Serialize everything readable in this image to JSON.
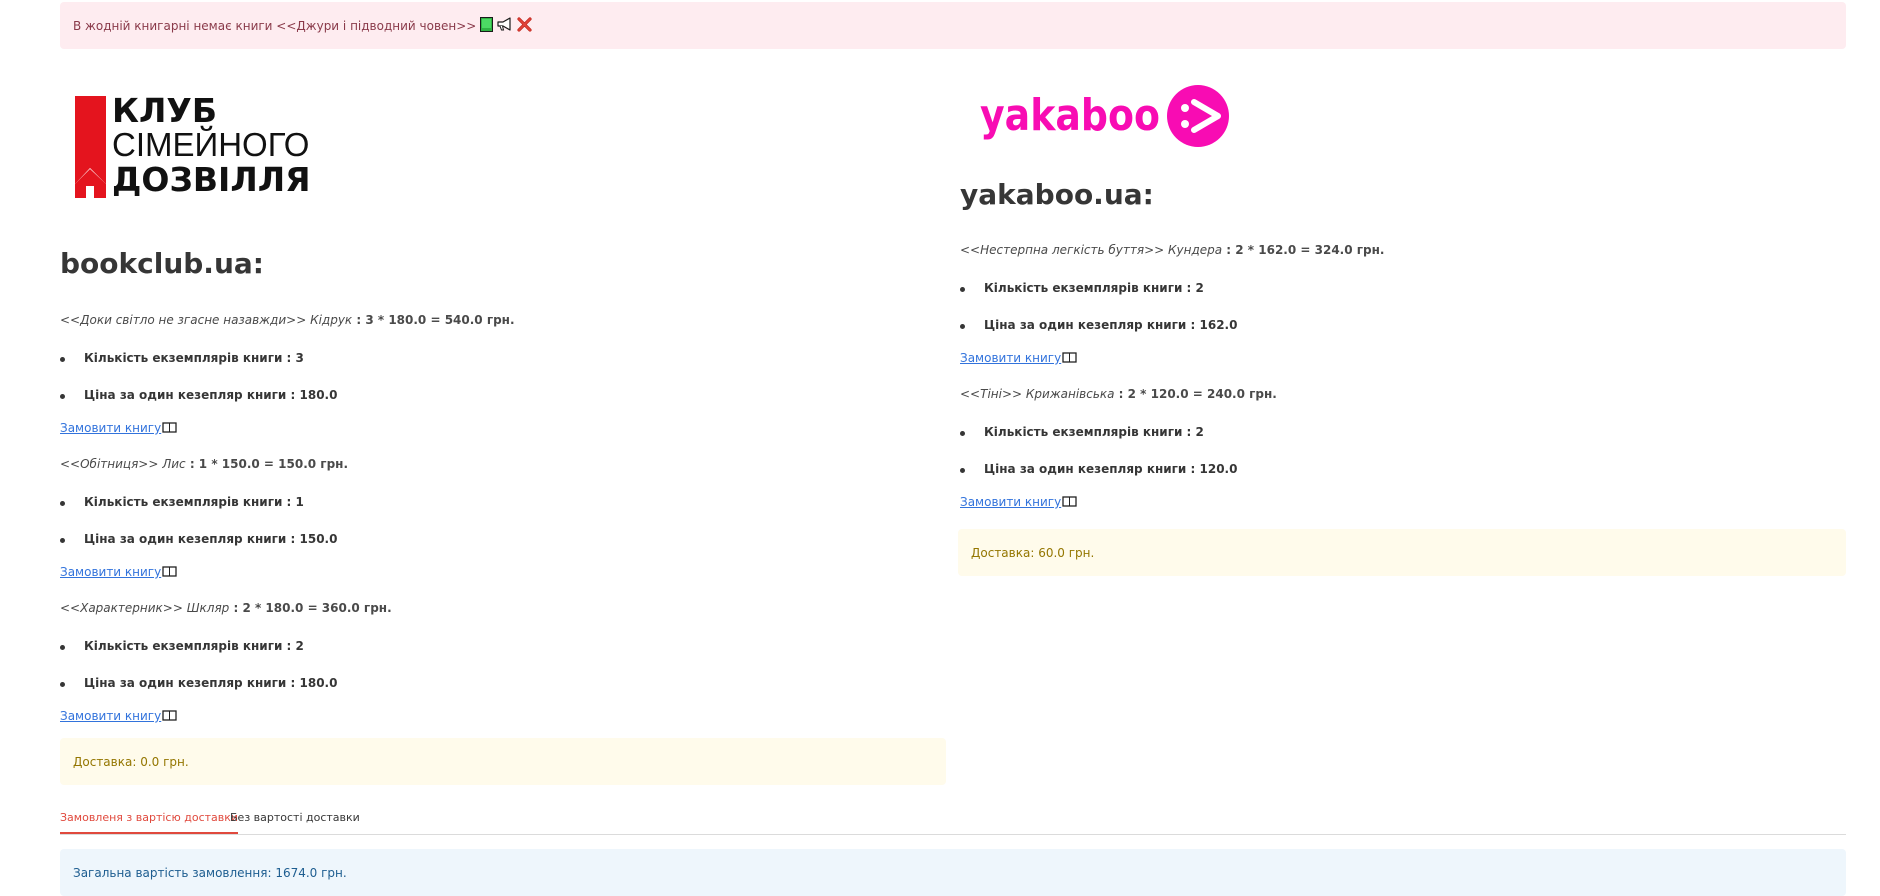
{
  "alert": {
    "message": "В жодній книгарні немає книги <<Джури і підводний човен>>",
    "icons": [
      "book-icon",
      "megaphone-icon",
      "close-icon"
    ]
  },
  "shops": [
    {
      "logo_text": [
        "КЛУБ",
        "СІМЕЙНОГО",
        "ДОЗВІЛЛЯ"
      ],
      "title": "bookclub.ua:",
      "books": [
        {
          "title_author": "<<Доки світло не згасне назавжди>> Кідрук",
          "calc": " : 3 * 180.0 = 540.0 грн.",
          "qty": "Кількість екземплярів книги : 3",
          "price": "Ціна за один кезепляр книги : 180.0",
          "order": "Замовити книгу"
        },
        {
          "title_author": "<<Обітниця>> Лис",
          "calc": " : 1 * 150.0 = 150.0 грн.",
          "qty": "Кількість екземплярів книги : 1",
          "price": "Ціна за один кезепляр книги : 150.0",
          "order": "Замовити книгу"
        },
        {
          "title_author": "<<Характерник>> Шкляр",
          "calc": " : 2 * 180.0 = 360.0 грн.",
          "qty": "Кількість екземплярів книги : 2",
          "price": "Ціна за один кезепляр книги : 180.0",
          "order": "Замовити книгу"
        }
      ],
      "delivery": "Доставка: 0.0 грн."
    },
    {
      "logo_text": "yakaboo",
      "title": "yakaboo.ua:",
      "books": [
        {
          "title_author": "<<Нестерпна легкість буття>> Кундера",
          "calc": " : 2 * 162.0 = 324.0 грн.",
          "qty": "Кількість екземплярів книги : 2",
          "price": "Ціна за один кезепляр книги : 162.0",
          "order": "Замовити книгу"
        },
        {
          "title_author": "<<Тіні>> Крижанівська",
          "calc": " : 2 * 120.0 = 240.0 грн.",
          "qty": "Кількість екземплярів книги : 2",
          "price": "Ціна за один кезепляр книги : 120.0",
          "order": "Замовити книгу"
        }
      ],
      "delivery": "Доставка: 60.0 грн."
    }
  ],
  "tabs": [
    {
      "label": "Замовленя з вартісю доставки",
      "active": true
    },
    {
      "label": "Без вартості доставки",
      "active": false
    }
  ],
  "total": "Загальна вартість замовлення: 1674.0 грн.",
  "colors": {
    "danger_bg": "#feecf0",
    "warning_bg": "#fffbeb",
    "info_bg": "#eef6fc",
    "link": "#3273dc",
    "tab_active": "#e0493d",
    "yakaboo_pink": "#f80cb3",
    "bookclub_red": "#e4141e"
  }
}
